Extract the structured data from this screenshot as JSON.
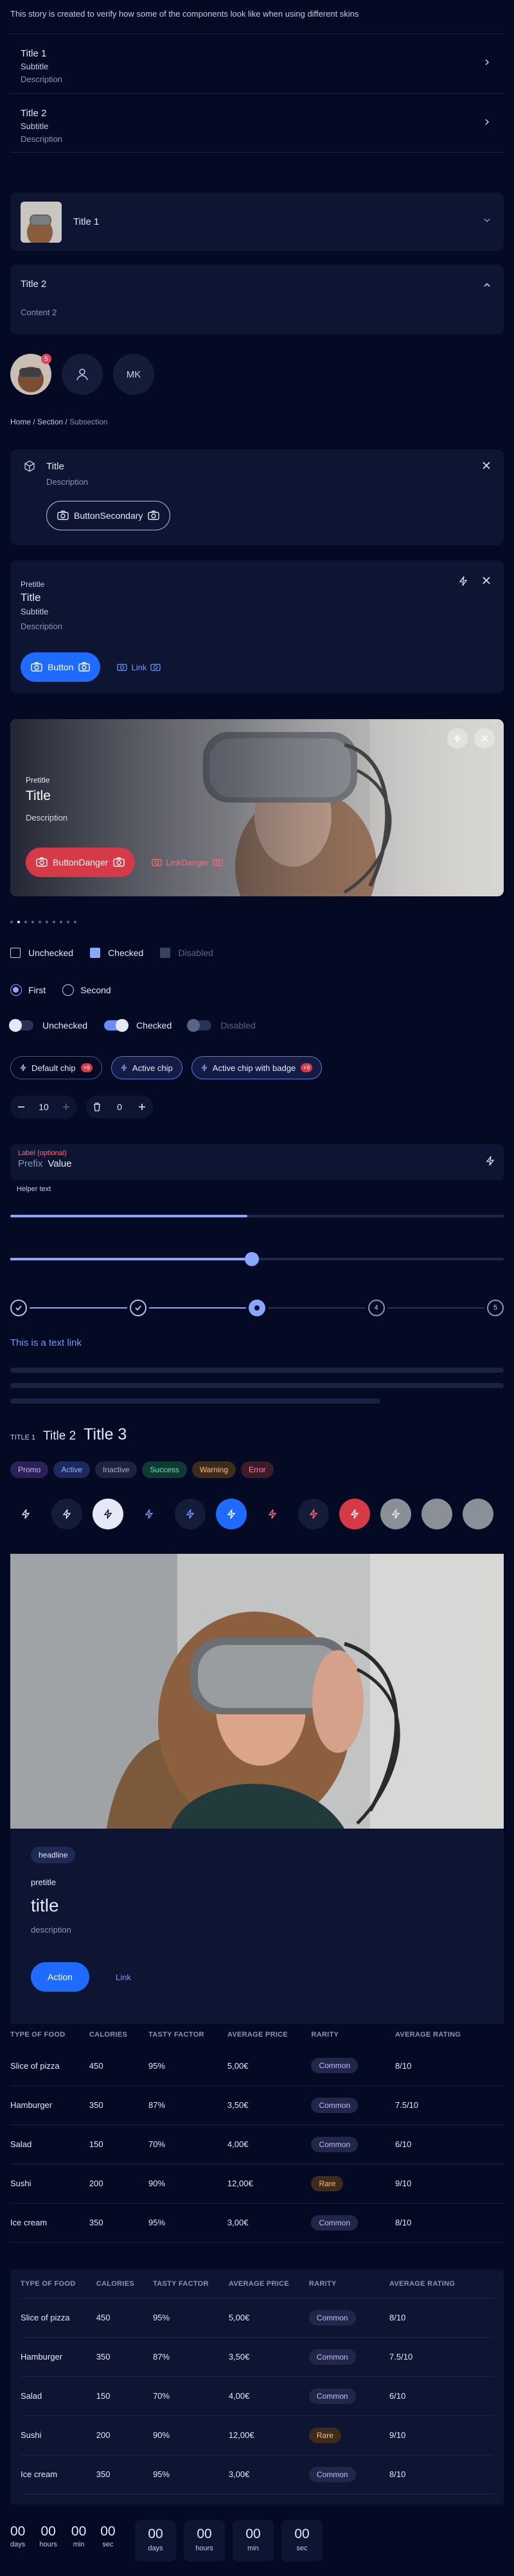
{
  "intro": "This story is created to verify how some of the components look like when using different skins",
  "list_items": [
    {
      "title": "Title 1",
      "subtitle": "Subtitle",
      "description": "Description"
    },
    {
      "title": "Title 2",
      "subtitle": "Subtitle",
      "description": "Description"
    }
  ],
  "accordion": {
    "item1_title": "Title 1",
    "item2_title": "Title 2",
    "item2_content": "Content 2"
  },
  "avatars": {
    "badge": "5",
    "initials": "MK"
  },
  "breadcrumb": {
    "home": "Home",
    "section": "Section",
    "sep": "/",
    "current": "Subsection"
  },
  "notification": {
    "title": "Title",
    "description": "Description",
    "button": "ButtonSecondary"
  },
  "card": {
    "pretitle": "Pretitle",
    "title": "Title",
    "subtitle": "Subtitle",
    "description": "Description",
    "button": "Button",
    "link": "Link"
  },
  "hero": {
    "pretitle": "Pretitle",
    "title": "Title",
    "description": "Description",
    "button": "ButtonDanger",
    "link": "LinkDanger"
  },
  "carousel": {
    "count": 10,
    "active": 1
  },
  "checkboxes": {
    "unchecked": "Unchecked",
    "checked": "Checked",
    "disabled": "Disabled"
  },
  "radios": {
    "first": "First",
    "second": "Second"
  },
  "switches": {
    "unchecked": "Unchecked",
    "checked": "Checked",
    "disabled": "Disabled"
  },
  "chips": {
    "default": "Default chip",
    "default_badge": "+9",
    "active": "Active chip",
    "badge_chip": "Active chip with badge",
    "badge_chip_badge": "+9"
  },
  "steppers": {
    "value1": "10",
    "value2": "0"
  },
  "field": {
    "label": "Label (optional)",
    "prefix": "Prefix",
    "value": "Value",
    "helper": "Helper text"
  },
  "progress": 0.48,
  "slider": 0.49,
  "step_indicator": {
    "nodes": [
      "",
      "",
      "3",
      "4",
      "5"
    ],
    "current": 2
  },
  "text_link": "This is a text link",
  "titles": {
    "t1": "TITLE 1",
    "t2": "Title 2",
    "t3": "Title 3"
  },
  "tags": [
    {
      "label": "Promo",
      "bg": "#2c2156",
      "fg": "#c9b6ff"
    },
    {
      "label": "Active",
      "bg": "#1b2a5a",
      "fg": "#9bb8ff"
    },
    {
      "label": "Inactive",
      "bg": "#1d2340",
      "fg": "#aab2cc"
    },
    {
      "label": "Success",
      "bg": "#0f3a34",
      "fg": "#6fe0b8"
    },
    {
      "label": "Warning",
      "bg": "#3d2c1c",
      "fg": "#ffbf7a"
    },
    {
      "label": "Error",
      "bg": "#3d1c2a",
      "fg": "#ff8fa3"
    }
  ],
  "icon_buttons": [
    "bolt-icon",
    "bolt-icon",
    "bolt-icon",
    "bolt-icon",
    "bolt-icon",
    "bolt-icon",
    "bolt-icon",
    "bolt-icon",
    "bolt-icon",
    "bolt-icon",
    "circle",
    "circle"
  ],
  "data_card": {
    "headline": "headline",
    "pretitle": "pretitle",
    "title": "title",
    "description": "description",
    "action": "Action",
    "link": "Link"
  },
  "table": {
    "headers": [
      "TYPE OF FOOD",
      "CALORIES",
      "TASTY FACTOR",
      "AVERAGE PRICE",
      "RARITY",
      "AVERAGE RATING"
    ],
    "rows": [
      [
        "Slice of pizza",
        "450",
        "95%",
        "5,00€",
        "Common",
        "8/10"
      ],
      [
        "Hamburger",
        "350",
        "87%",
        "3,50€",
        "Common",
        "7.5/10"
      ],
      [
        "Salad",
        "150",
        "70%",
        "4,00€",
        "Common",
        "6/10"
      ],
      [
        "Sushi",
        "200",
        "90%",
        "12,00€",
        "Rare",
        "9/10"
      ],
      [
        "Ice cream",
        "350",
        "95%",
        "3,00€",
        "Common",
        "8/10"
      ]
    ]
  },
  "countdown": {
    "days": "00",
    "hours": "00",
    "min": "00",
    "sec": "00",
    "l_days": "days",
    "l_hours": "hours",
    "l_min": "min",
    "l_sec": "sec"
  },
  "colors": {
    "bg": "#050a24",
    "card": "#0d1533",
    "primary": "#1f6bff",
    "danger": "#d63a47",
    "accent": "#8aa6ff",
    "link": "#6b9bff"
  }
}
